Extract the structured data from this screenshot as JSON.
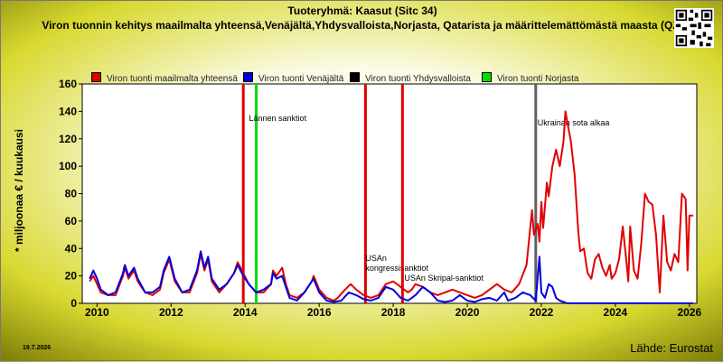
{
  "header": {
    "title": "Tuoteryhmä: Kaasut (Sitc 34)",
    "subtitle": "Viron tuonnin kehitys maailmalta yhteensä,Venäjältä,Yhdysvalloista,Norjasta, Qatarista ja määrittelemättömästä maasta (QZ)"
  },
  "footer": {
    "date": "19.7.2026",
    "source": "Lähde: Eurostat"
  },
  "colors": {
    "total": "#e00000",
    "russia": "#0000dd",
    "usa": "#000000",
    "norway": "#00dd00",
    "war_line": "#606060"
  },
  "chart_data": {
    "type": "line",
    "ylabel": "* miljoonaa € / kuukausi",
    "xlabel": "",
    "xlim": [
      2009.6,
      2026.2
    ],
    "ylim": [
      0,
      160
    ],
    "yticks": [
      0,
      20,
      40,
      60,
      80,
      100,
      120,
      140,
      160
    ],
    "xticks": [
      2010,
      2012,
      2014,
      2016,
      2018,
      2020,
      2022,
      2024,
      2026
    ],
    "grid": false,
    "legend_position": "top",
    "series": [
      {
        "name": "Viron tuonti maailmalta yhteensä",
        "color": "#e00000",
        "points": [
          [
            2009.8,
            16
          ],
          [
            2009.9,
            20
          ],
          [
            2010.0,
            14
          ],
          [
            2010.1,
            8
          ],
          [
            2010.3,
            6
          ],
          [
            2010.5,
            6
          ],
          [
            2010.7,
            20
          ],
          [
            2010.75,
            26
          ],
          [
            2010.85,
            18
          ],
          [
            2011.0,
            24
          ],
          [
            2011.1,
            16
          ],
          [
            2011.3,
            8
          ],
          [
            2011.5,
            6
          ],
          [
            2011.7,
            10
          ],
          [
            2011.8,
            22
          ],
          [
            2011.95,
            32
          ],
          [
            2012.1,
            16
          ],
          [
            2012.3,
            8
          ],
          [
            2012.5,
            8
          ],
          [
            2012.7,
            22
          ],
          [
            2012.8,
            36
          ],
          [
            2012.9,
            24
          ],
          [
            2013.0,
            32
          ],
          [
            2013.1,
            16
          ],
          [
            2013.3,
            8
          ],
          [
            2013.5,
            14
          ],
          [
            2013.7,
            22
          ],
          [
            2013.8,
            30
          ],
          [
            2013.95,
            22
          ],
          [
            2014.1,
            14
          ],
          [
            2014.3,
            8
          ],
          [
            2014.5,
            8
          ],
          [
            2014.7,
            14
          ],
          [
            2014.75,
            24
          ],
          [
            2014.85,
            20
          ],
          [
            2015.0,
            26
          ],
          [
            2015.1,
            14
          ],
          [
            2015.2,
            6
          ],
          [
            2015.4,
            4
          ],
          [
            2015.6,
            8
          ],
          [
            2015.8,
            16
          ],
          [
            2015.85,
            20
          ],
          [
            2016.0,
            10
          ],
          [
            2016.2,
            4
          ],
          [
            2016.4,
            2
          ],
          [
            2016.5,
            4
          ],
          [
            2016.7,
            10
          ],
          [
            2016.85,
            14
          ],
          [
            2017.0,
            10
          ],
          [
            2017.2,
            6
          ],
          [
            2017.4,
            4
          ],
          [
            2017.6,
            6
          ],
          [
            2017.8,
            14
          ],
          [
            2018.0,
            16
          ],
          [
            2018.2,
            12
          ],
          [
            2018.4,
            8
          ],
          [
            2018.5,
            10
          ],
          [
            2018.6,
            14
          ],
          [
            2018.8,
            12
          ],
          [
            2019.0,
            8
          ],
          [
            2019.2,
            6
          ],
          [
            2019.4,
            8
          ],
          [
            2019.6,
            10
          ],
          [
            2019.8,
            8
          ],
          [
            2020.0,
            6
          ],
          [
            2020.2,
            4
          ],
          [
            2020.4,
            6
          ],
          [
            2020.6,
            10
          ],
          [
            2020.8,
            14
          ],
          [
            2021.0,
            10
          ],
          [
            2021.2,
            8
          ],
          [
            2021.4,
            14
          ],
          [
            2021.6,
            28
          ],
          [
            2021.75,
            68
          ],
          [
            2021.8,
            50
          ],
          [
            2021.9,
            58
          ],
          [
            2021.95,
            45
          ],
          [
            2022.0,
            74
          ],
          [
            2022.05,
            55
          ],
          [
            2022.15,
            88
          ],
          [
            2022.2,
            78
          ],
          [
            2022.3,
            100
          ],
          [
            2022.4,
            112
          ],
          [
            2022.5,
            100
          ],
          [
            2022.6,
            118
          ],
          [
            2022.65,
            140
          ],
          [
            2022.8,
            118
          ],
          [
            2022.9,
            94
          ],
          [
            2023.0,
            52
          ],
          [
            2023.05,
            38
          ],
          [
            2023.15,
            40
          ],
          [
            2023.25,
            22
          ],
          [
            2023.35,
            18
          ],
          [
            2023.45,
            32
          ],
          [
            2023.55,
            36
          ],
          [
            2023.65,
            26
          ],
          [
            2023.75,
            20
          ],
          [
            2023.85,
            28
          ],
          [
            2023.9,
            18
          ],
          [
            2024.0,
            22
          ],
          [
            2024.1,
            32
          ],
          [
            2024.2,
            56
          ],
          [
            2024.3,
            30
          ],
          [
            2024.35,
            16
          ],
          [
            2024.4,
            56
          ],
          [
            2024.5,
            24
          ],
          [
            2024.6,
            18
          ],
          [
            2024.7,
            44
          ],
          [
            2024.8,
            80
          ],
          [
            2024.9,
            74
          ],
          [
            2025.0,
            72
          ],
          [
            2025.1,
            50
          ],
          [
            2025.2,
            8
          ],
          [
            2025.3,
            64
          ],
          [
            2025.4,
            30
          ],
          [
            2025.5,
            24
          ],
          [
            2025.6,
            36
          ],
          [
            2025.7,
            30
          ],
          [
            2025.8,
            80
          ],
          [
            2025.9,
            76
          ],
          [
            2025.95,
            24
          ],
          [
            2026.0,
            64
          ],
          [
            2026.1,
            64
          ]
        ]
      },
      {
        "name": "Viron tuonti Venäjältä",
        "color": "#0000dd",
        "points": [
          [
            2009.8,
            18
          ],
          [
            2009.9,
            24
          ],
          [
            2010.0,
            18
          ],
          [
            2010.1,
            10
          ],
          [
            2010.3,
            6
          ],
          [
            2010.5,
            8
          ],
          [
            2010.7,
            22
          ],
          [
            2010.75,
            28
          ],
          [
            2010.85,
            20
          ],
          [
            2011.0,
            26
          ],
          [
            2011.1,
            18
          ],
          [
            2011.3,
            8
          ],
          [
            2011.5,
            8
          ],
          [
            2011.7,
            12
          ],
          [
            2011.8,
            24
          ],
          [
            2011.95,
            34
          ],
          [
            2012.1,
            18
          ],
          [
            2012.3,
            8
          ],
          [
            2012.5,
            10
          ],
          [
            2012.7,
            24
          ],
          [
            2012.8,
            38
          ],
          [
            2012.9,
            26
          ],
          [
            2013.0,
            34
          ],
          [
            2013.1,
            18
          ],
          [
            2013.3,
            10
          ],
          [
            2013.5,
            14
          ],
          [
            2013.7,
            22
          ],
          [
            2013.8,
            28
          ],
          [
            2013.95,
            20
          ],
          [
            2014.1,
            14
          ],
          [
            2014.3,
            8
          ],
          [
            2014.5,
            10
          ],
          [
            2014.7,
            14
          ],
          [
            2014.75,
            22
          ],
          [
            2014.85,
            18
          ],
          [
            2015.0,
            20
          ],
          [
            2015.1,
            12
          ],
          [
            2015.2,
            4
          ],
          [
            2015.4,
            2
          ],
          [
            2015.6,
            8
          ],
          [
            2015.8,
            16
          ],
          [
            2015.85,
            18
          ],
          [
            2016.0,
            8
          ],
          [
            2016.2,
            2
          ],
          [
            2016.4,
            1
          ],
          [
            2016.6,
            2
          ],
          [
            2016.8,
            8
          ],
          [
            2017.0,
            6
          ],
          [
            2017.2,
            3
          ],
          [
            2017.4,
            2
          ],
          [
            2017.6,
            4
          ],
          [
            2017.8,
            12
          ],
          [
            2018.0,
            10
          ],
          [
            2018.2,
            4
          ],
          [
            2018.4,
            2
          ],
          [
            2018.6,
            6
          ],
          [
            2018.8,
            12
          ],
          [
            2019.0,
            8
          ],
          [
            2019.2,
            2
          ],
          [
            2019.4,
            1
          ],
          [
            2019.6,
            2
          ],
          [
            2019.8,
            6
          ],
          [
            2020.0,
            2
          ],
          [
            2020.2,
            1
          ],
          [
            2020.4,
            3
          ],
          [
            2020.6,
            4
          ],
          [
            2020.8,
            2
          ],
          [
            2021.0,
            8
          ],
          [
            2021.1,
            2
          ],
          [
            2021.3,
            4
          ],
          [
            2021.5,
            8
          ],
          [
            2021.7,
            6
          ],
          [
            2021.85,
            2
          ],
          [
            2021.95,
            34
          ],
          [
            2022.0,
            8
          ],
          [
            2022.1,
            4
          ],
          [
            2022.2,
            14
          ],
          [
            2022.3,
            12
          ],
          [
            2022.4,
            4
          ],
          [
            2022.5,
            2
          ],
          [
            2022.7,
            0
          ],
          [
            2023.0,
            0
          ],
          [
            2023.5,
            0
          ],
          [
            2024.0,
            0
          ],
          [
            2024.5,
            0
          ],
          [
            2025.0,
            0
          ],
          [
            2025.5,
            0
          ],
          [
            2026.1,
            0
          ]
        ]
      },
      {
        "name": "Viron tuonti Yhdysvalloista",
        "color": "#000000",
        "points": []
      },
      {
        "name": "Viron tuonti Norjasta",
        "color": "#00dd00",
        "points": []
      }
    ],
    "vertical_markers": [
      {
        "x": 2013.95,
        "color": "#e00000",
        "label": ""
      },
      {
        "x": 2014.3,
        "color": "#00dd00",
        "label": "Lännen sanktiot"
      },
      {
        "x": 2017.25,
        "color": "#e00000",
        "label": "USAn kongressisanktiot"
      },
      {
        "x": 2018.25,
        "color": "#e00000",
        "label": "USAn Skripal-sanktiot"
      },
      {
        "x": 2021.85,
        "color": "#606060",
        "label": "Ukrainan sota alkaa"
      }
    ]
  }
}
